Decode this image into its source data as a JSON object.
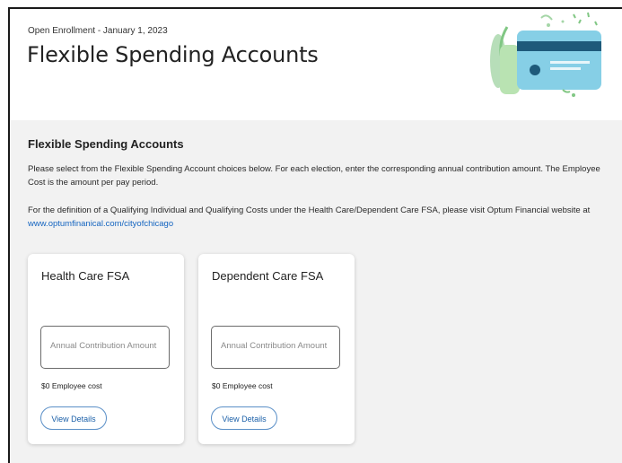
{
  "header": {
    "eyebrow": "Open Enrollment - January 1, 2023",
    "title": "Flexible Spending Accounts"
  },
  "section": {
    "title": "Flexible Spending Accounts",
    "para1": "Please select from the Flexible Spending Account choices below. For each election, enter the corresponding annual contribution amount. The Employee Cost is the amount per pay period.",
    "para2_prefix": "For the definition of a Qualifying Individual and Qualifying Costs under the Health Care/Dependent Care FSA, please visit Optum Financial website at ",
    "link_text": "www.optumfinanical.com/cityofchicago"
  },
  "cards": [
    {
      "title": "Health Care FSA",
      "input_placeholder": "Annual Contribution Amount",
      "employee_cost": "$0 Employee cost",
      "button_label": "View Details"
    },
    {
      "title": "Dependent Care FSA",
      "input_placeholder": "Annual Contribution Amount",
      "employee_cost": "$0 Employee cost",
      "button_label": "View Details"
    }
  ],
  "colors": {
    "link": "#1565c0",
    "content_bg": "#f2f2f2",
    "card_illustration": "#86cfe6"
  }
}
